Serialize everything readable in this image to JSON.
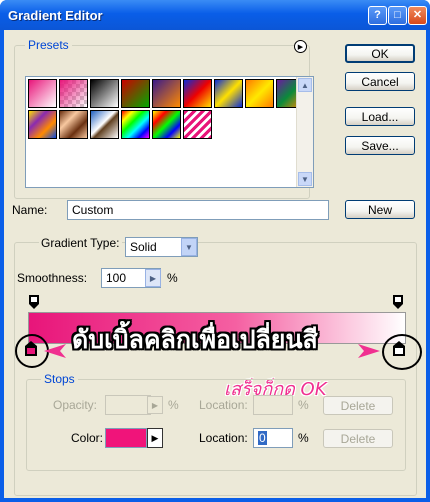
{
  "window": {
    "title": "Gradient Editor"
  },
  "presets": {
    "legend": "Presets",
    "swatches": [
      {
        "name": "fg-to-bg",
        "css": "linear-gradient(135deg,#e8157a,#fff)"
      },
      {
        "name": "fg-to-transparent",
        "css": "linear-gradient(135deg,#e8157a,rgba(255,255,255,0)),repeating-conic-gradient(#ccc 0 25%,#fff 0 50%) 0 0/8px 8px"
      },
      {
        "name": "black-white",
        "css": "linear-gradient(135deg,#000,#fff)"
      },
      {
        "name": "red-green",
        "css": "linear-gradient(135deg,#c00,#0a0)"
      },
      {
        "name": "violet-orange",
        "css": "linear-gradient(135deg,#3a1a8a,#ff8a00)"
      },
      {
        "name": "blue-red-yellow",
        "css": "linear-gradient(135deg,#0a2cd8,#e00,#ffe000)"
      },
      {
        "name": "blue-yellow-blue",
        "css": "linear-gradient(135deg,#0a2cd8,#ffe000,#0a2cd8)"
      },
      {
        "name": "orange-yellow-orange",
        "css": "linear-gradient(135deg,#ff7a00,#ffe800,#ff7a00)"
      },
      {
        "name": "violet-green-orange",
        "css": "linear-gradient(135deg,#6a1aa0,#0a8a3a,#ff8a00)"
      },
      {
        "name": "yellow-violet-orange-blue",
        "css": "linear-gradient(135deg,#ffe000,#8a2ab0,#ff8a00,#0a4ae0)"
      },
      {
        "name": "copper",
        "css": "linear-gradient(135deg,#6a3010,#f8c8a0,#6a3010,#f8c8a0)"
      },
      {
        "name": "chrome",
        "css": "linear-gradient(135deg,#2060c0,#fff 45%,#604020 55%,#fff)"
      },
      {
        "name": "spectrum",
        "css": "linear-gradient(135deg,#f00,#ff0,#0f0,#0ff,#00f,#f0f)"
      },
      {
        "name": "transparent-rainbow",
        "css": "linear-gradient(135deg,#ff0,#f00,#0f0,#00f,#ff0)"
      },
      {
        "name": "transparent-stripes",
        "css": "repeating-linear-gradient(135deg,#e8157a 0 3px,#fff 3px 6px)"
      }
    ]
  },
  "buttons": {
    "ok": "OK",
    "cancel": "Cancel",
    "load": "Load...",
    "save": "Save...",
    "new": "New"
  },
  "name_field": {
    "label": "Name:",
    "value": "Custom"
  },
  "gradient_type": {
    "label": "Gradient Type:",
    "value": "Solid"
  },
  "smoothness": {
    "label": "Smoothness:",
    "value": "100",
    "unit": "%"
  },
  "gradient": {
    "start_color": "#e8157a",
    "end_color": "#ffffff"
  },
  "annotation": {
    "main_text": "ดับเบิ้ลคลิกเพื่อเปลี่ยนสี",
    "sub_text": "เสร็จก็กด OK",
    "main_color": "#ffffff",
    "sub_color": "#f03090"
  },
  "stops": {
    "legend": "Stops",
    "opacity_label": "Opacity:",
    "opacity_unit": "%",
    "location_label_1": "Location:",
    "location_unit_1": "%",
    "delete_label_1": "Delete",
    "color_label": "Color:",
    "color_value": "#f0147a",
    "location_label_2": "Location:",
    "location_value": "0",
    "location_unit_2": "%",
    "delete_label_2": "Delete"
  }
}
